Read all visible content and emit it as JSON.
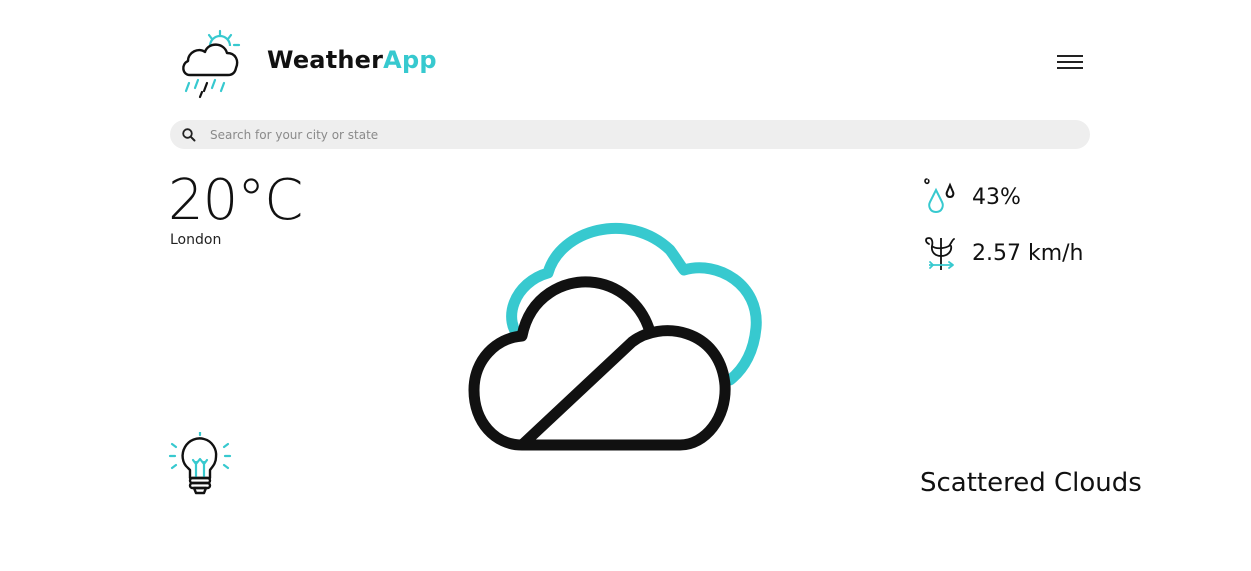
{
  "header": {
    "brand_part1": "Weather",
    "brand_part2": "App",
    "logo_icon": "cloud-rain-sun-icon",
    "menu_icon": "hamburger-menu-icon"
  },
  "search": {
    "placeholder": "Search for your city or state",
    "value": "",
    "icon": "search-icon"
  },
  "current": {
    "temperature": "20°C",
    "city": "London",
    "description": "Scattered Clouds",
    "condition_icon": "scattered-clouds-icon"
  },
  "stats": {
    "humidity": "43%",
    "humidity_icon": "humidity-drops-icon",
    "wind": "2.57 km/h",
    "wind_icon": "weather-vane-icon"
  },
  "tip_icon": "lightbulb-icon",
  "colors": {
    "accent": "#37c9cf",
    "text": "#111111",
    "search_bg": "#eeeeee"
  }
}
